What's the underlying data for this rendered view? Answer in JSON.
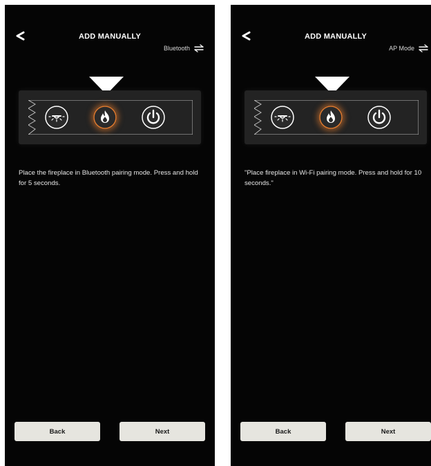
{
  "screens": [
    {
      "title": "ADD MANUALLY",
      "mode_label": "Bluetooth",
      "instruction": "Place the fireplace in Bluetooth pairing mode. Press and hold for 5 seconds.",
      "back_label": "Back",
      "next_label": "Next"
    },
    {
      "title": "ADD MANUALLY",
      "mode_label": "AP Mode",
      "instruction": "\"Place fireplace in Wi-Fi pairing mode. Press and hold for 10 seconds.\"",
      "back_label": "Back",
      "next_label": "Next"
    }
  ],
  "icons": {
    "back": "chevron-left-icon",
    "mode_switch": "swap-arrows-icon",
    "pointer": "down-triangle-icon",
    "light": "light-icon",
    "flame": "flame-icon",
    "power": "power-icon"
  },
  "colors": {
    "background": "#050505",
    "panel": "#232323",
    "button": "#e6e5df",
    "flame_glow": "#e07a2e"
  },
  "highlighted_control": "flame"
}
